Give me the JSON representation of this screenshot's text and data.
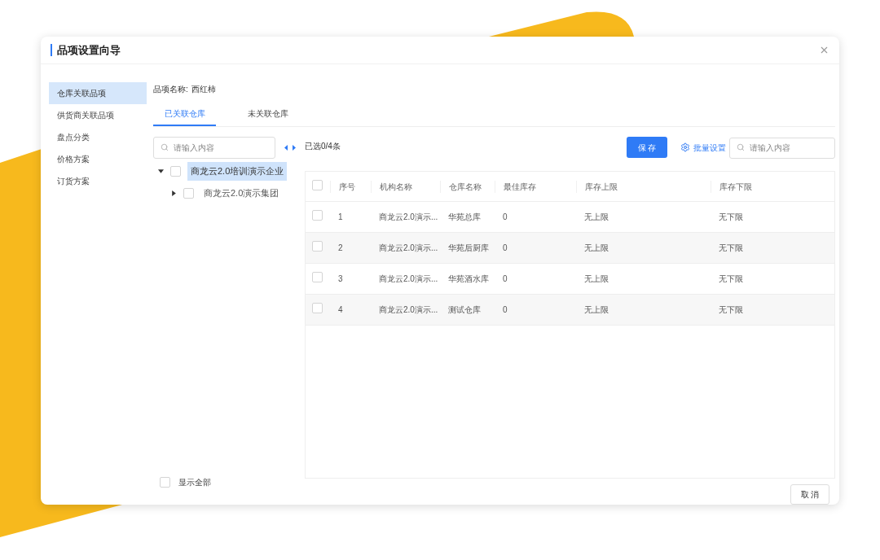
{
  "dialog": {
    "title": "品项设置向导"
  },
  "sidebar": {
    "items": [
      {
        "label": "仓库关联品项",
        "selected": true
      },
      {
        "label": "供货商关联品项",
        "selected": false
      },
      {
        "label": "盘点分类",
        "selected": false
      },
      {
        "label": "价格方案",
        "selected": false
      },
      {
        "label": "订货方案",
        "selected": false
      }
    ]
  },
  "item_name": {
    "label": "品项名称:",
    "value": "西红柿"
  },
  "tabs": [
    {
      "label": "已关联仓库",
      "selected": true
    },
    {
      "label": "未关联仓库",
      "selected": false
    }
  ],
  "tree_search": {
    "placeholder": "请输入内容"
  },
  "tree": [
    {
      "label": "商龙云2.0培训演示企业",
      "checked": false,
      "expanded": true,
      "selected": true,
      "children": [
        {
          "label": "商龙云2.0演示集团",
          "checked": false,
          "expanded": false,
          "selected": false
        }
      ]
    }
  ],
  "selection_count": "已选0/4条",
  "save_button": "保 存",
  "batch_settings": "批量设置",
  "table_search": {
    "placeholder": "请输入内容"
  },
  "table": {
    "header_checked": false,
    "columns": [
      "序号",
      "机构名称",
      "仓库名称",
      "最佳库存",
      "库存上限",
      "库存下限"
    ],
    "rows": [
      {
        "checked": false,
        "cells": [
          "1",
          "商龙云2.0演示...",
          "华苑总库",
          "0",
          "无上限",
          "无下限"
        ]
      },
      {
        "checked": false,
        "cells": [
          "2",
          "商龙云2.0演示...",
          "华苑后厨库",
          "0",
          "无上限",
          "无下限"
        ]
      },
      {
        "checked": false,
        "cells": [
          "3",
          "商龙云2.0演示...",
          "华苑酒水库",
          "0",
          "无上限",
          "无下限"
        ]
      },
      {
        "checked": false,
        "cells": [
          "4",
          "商龙云2.0演示...",
          "测试仓库",
          "0",
          "无上限",
          "无下限"
        ]
      }
    ]
  },
  "show_all": {
    "label": "显示全部",
    "checked": false
  },
  "cancel_button": "取 消"
}
